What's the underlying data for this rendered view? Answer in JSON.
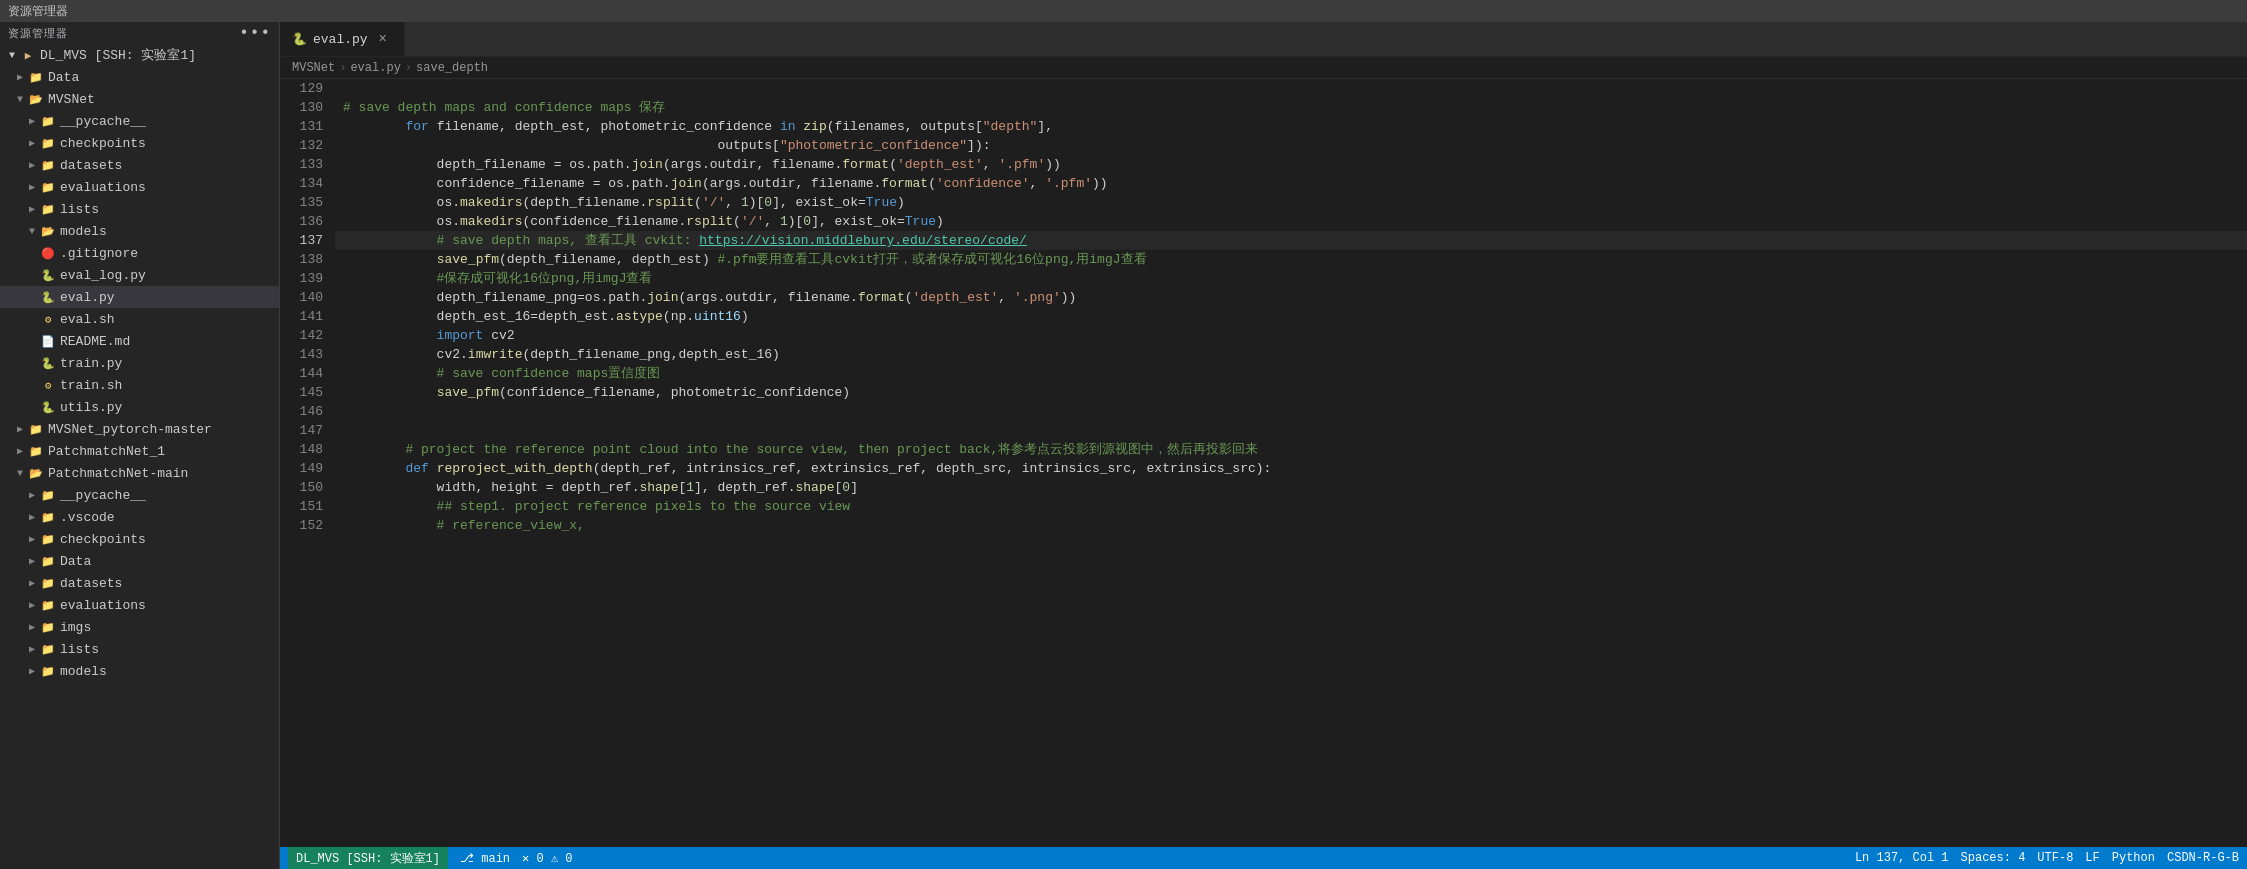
{
  "titlebar": {
    "label": "资源管理器"
  },
  "sidebar": {
    "header": "资源管理器",
    "root": "DL_MVS [SSH: 实验室1]",
    "tree": [
      {
        "id": "data-top",
        "label": "Data",
        "type": "folder",
        "indent": 1,
        "expanded": false
      },
      {
        "id": "mvsnet",
        "label": "MVSNet",
        "type": "folder-open",
        "indent": 1,
        "expanded": true
      },
      {
        "id": "pycache-1",
        "label": "__pycache__",
        "type": "folder",
        "indent": 2,
        "expanded": false
      },
      {
        "id": "checkpoints-1",
        "label": "checkpoints",
        "type": "folder",
        "indent": 2,
        "expanded": false
      },
      {
        "id": "datasets-1",
        "label": "datasets",
        "type": "folder",
        "indent": 2,
        "expanded": false
      },
      {
        "id": "evaluations-1",
        "label": "evaluations",
        "type": "folder",
        "indent": 2,
        "expanded": false
      },
      {
        "id": "lists-1",
        "label": "lists",
        "type": "folder",
        "indent": 2,
        "expanded": false
      },
      {
        "id": "models-1",
        "label": "models",
        "type": "folder-open",
        "indent": 2,
        "expanded": true
      },
      {
        "id": "gitignore",
        "label": ".gitignore",
        "type": "gitignore",
        "indent": 2,
        "expanded": false
      },
      {
        "id": "eval-log",
        "label": "eval_log.py",
        "type": "py",
        "indent": 2,
        "expanded": false
      },
      {
        "id": "eval-py",
        "label": "eval.py",
        "type": "py",
        "indent": 2,
        "expanded": false,
        "selected": true
      },
      {
        "id": "eval-sh",
        "label": "eval.sh",
        "type": "sh",
        "indent": 2,
        "expanded": false
      },
      {
        "id": "readme",
        "label": "README.md",
        "type": "md",
        "indent": 2,
        "expanded": false
      },
      {
        "id": "train-py",
        "label": "train.py",
        "type": "py",
        "indent": 2,
        "expanded": false
      },
      {
        "id": "train-sh",
        "label": "train.sh",
        "type": "sh",
        "indent": 2,
        "expanded": false
      },
      {
        "id": "utils-py",
        "label": "utils.py",
        "type": "py",
        "indent": 2,
        "expanded": false
      },
      {
        "id": "mvsnet-pytorch",
        "label": "MVSNet_pytorch-master",
        "type": "folder",
        "indent": 1,
        "expanded": false
      },
      {
        "id": "patchmatch-1",
        "label": "PatchmatchNet_1",
        "type": "folder",
        "indent": 1,
        "expanded": false
      },
      {
        "id": "patchmatch-main",
        "label": "PatchmatchNet-main",
        "type": "folder-open",
        "indent": 1,
        "expanded": true
      },
      {
        "id": "pycache-pm",
        "label": "__pycache__",
        "type": "folder",
        "indent": 2,
        "expanded": false
      },
      {
        "id": "vscode-pm",
        "label": ".vscode",
        "type": "folder",
        "indent": 2,
        "expanded": false
      },
      {
        "id": "checkpoints-pm",
        "label": "checkpoints",
        "type": "folder",
        "indent": 2,
        "expanded": false
      },
      {
        "id": "data-pm",
        "label": "Data",
        "type": "folder",
        "indent": 2,
        "expanded": false
      },
      {
        "id": "datasets-pm",
        "label": "datasets",
        "type": "folder",
        "indent": 2,
        "expanded": false
      },
      {
        "id": "evaluations-pm",
        "label": "evaluations",
        "type": "folder",
        "indent": 2,
        "expanded": false
      },
      {
        "id": "imgspm",
        "label": "imgs",
        "type": "folder",
        "indent": 2,
        "expanded": false
      },
      {
        "id": "lists-pm",
        "label": "lists",
        "type": "folder",
        "indent": 2,
        "expanded": false
      },
      {
        "id": "models-pm",
        "label": "models",
        "type": "folder",
        "indent": 2,
        "expanded": false
      }
    ]
  },
  "tabs": [
    {
      "id": "eval-tab",
      "label": "eval.py",
      "icon": "py",
      "active": true,
      "closeable": true
    }
  ],
  "breadcrumb": [
    {
      "label": "MVSNet"
    },
    {
      "label": "eval.py"
    },
    {
      "label": "save_depth"
    }
  ],
  "editor": {
    "lines": [
      {
        "num": 129,
        "tokens": []
      },
      {
        "num": 130,
        "html": "<span class='cm'># save depth maps and confidence maps 保存</span>"
      },
      {
        "num": 131,
        "html": "<span class='kw'>        for</span><span class='op'> filename, depth_est, photometric_confidence </span><span class='kw'>in</span><span class='fn'> zip</span><span class='op'>(filenames, outputs[</span><span class='st'>\"depth\"</span><span class='op'>],</span>"
      },
      {
        "num": 132,
        "html": "<span class='op'>                                                outputs[</span><span class='st'>\"photometric_confidence\"</span><span class='op'>]):</span>"
      },
      {
        "num": 133,
        "html": "<span class='op'>            depth_filename = os.path.</span><span class='fn'>join</span><span class='op'>(args.outdir, filename.</span><span class='fn'>format</span><span class='op'>(</span><span class='st'>'depth_est'</span><span class='op'>, </span><span class='st'>'.pfm'</span><span class='op'>))</span>"
      },
      {
        "num": 134,
        "html": "<span class='op'>            confidence_filename = os.path.</span><span class='fn'>join</span><span class='op'>(args.outdir, filename.</span><span class='fn'>format</span><span class='op'>(</span><span class='st'>'confidence'</span><span class='op'>, </span><span class='st'>'.pfm'</span><span class='op'>))</span>"
      },
      {
        "num": 135,
        "html": "<span class='op'>            os.</span><span class='fn'>makedirs</span><span class='op'>(depth_filename.</span><span class='fn'>rsplit</span><span class='op'>(</span><span class='st'>'/'</span><span class='op'>, </span><span class='num'>1</span><span class='op'>)[</span><span class='num'>0</span><span class='op'>], exist_ok=</span><span class='kw'>True</span><span class='op'>)</span>"
      },
      {
        "num": 136,
        "html": "<span class='op'>            os.</span><span class='fn'>makedirs</span><span class='op'>(confidence_filename.</span><span class='fn'>rsplit</span><span class='op'>(</span><span class='st'>'/'</span><span class='op'>, </span><span class='num'>1</span><span class='op'>)[</span><span class='num'>0</span><span class='op'>], exist_ok=</span><span class='kw'>True</span><span class='op'>)</span>"
      },
      {
        "num": 137,
        "html": "<span class='cm'>            # save depth maps, 查看工具 cvkit: </span><span class='url'>https://vision.middlebury.edu/stereo/code/</span>",
        "active": true
      },
      {
        "num": 138,
        "html": "<span class='op'>            </span><span class='fn'>save_pfm</span><span class='op'>(depth_filename, depth_est) </span><span class='cm'>#.pfm要用查看工具cvkit打开，或者保存成可视化16位png,用imgJ查看</span>"
      },
      {
        "num": 139,
        "html": "<span class='cm'>            #保存成可视化16位png,用imgJ查看</span>"
      },
      {
        "num": 140,
        "html": "<span class='op'>            depth_filename_png=os.path.</span><span class='fn'>join</span><span class='op'>(args.outdir, filename.</span><span class='fn'>format</span><span class='op'>(</span><span class='st'>'depth_est'</span><span class='op'>, </span><span class='st'>'.png'</span><span class='op'>))</span>"
      },
      {
        "num": 141,
        "html": "<span class='op'>            depth_est_16=depth_est.</span><span class='fn'>astype</span><span class='op'>(np.</span><span class='lightblue'>uint16</span><span class='op'>)</span>"
      },
      {
        "num": 142,
        "html": "<span class='kw'>            import</span><span class='op'> cv2</span>"
      },
      {
        "num": 143,
        "html": "<span class='op'>            cv2.</span><span class='fn'>imwrite</span><span class='op'>(depth_filename_png,depth_est_16)</span>"
      },
      {
        "num": 144,
        "html": "<span class='cm'>            # save confidence maps置信度图</span>"
      },
      {
        "num": 145,
        "html": "<span class='op'>            </span><span class='fn'>save_pfm</span><span class='op'>(confidence_filename, photometric_confidence)</span>"
      },
      {
        "num": 146,
        "tokens": []
      },
      {
        "num": 147,
        "tokens": []
      },
      {
        "num": 148,
        "html": "<span class='cm'>        # project the reference point cloud into the source view, then project back,将参考点云投影到源视图中，然后再投影回来</span>"
      },
      {
        "num": 149,
        "html": "<span class='kw'>        def </span><span class='fn'>reproject_with_depth</span><span class='op'>(depth_ref, intrinsics_ref, extrinsics_ref, depth_src, intrinsics_src, extrinsics_src):</span>"
      },
      {
        "num": 150,
        "html": "<span class='op'>            width, height = depth_ref.</span><span class='fn'>shape</span><span class='op'>[</span><span class='num'>1</span><span class='op'>], depth_ref.</span><span class='fn'>shape</span><span class='op'>[</span><span class='num'>0</span><span class='op'>]</span>"
      },
      {
        "num": 151,
        "html": "<span class='cm'>            ## step1. project reference pixels to the source view</span>"
      },
      {
        "num": 152,
        "html": "<span class='cm'>            # reference_view_x,</span>"
      }
    ]
  },
  "statusbar": {
    "ssh": "DL_MVS [SSH: 实验室1]",
    "branch": "main",
    "errors": "0",
    "warnings": "0",
    "encoding": "UTF-8",
    "line_ending": "LF",
    "language": "Python",
    "ln_col": "Ln 137, Col 1",
    "spaces": "Spaces: 4",
    "right_label": "CSDN-R-G-B"
  }
}
